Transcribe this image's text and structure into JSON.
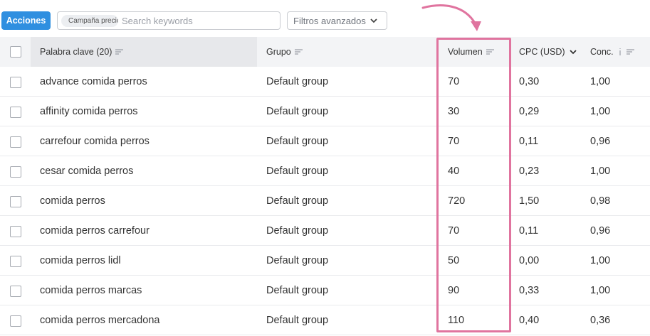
{
  "toolbar": {
    "actions_label": "Acciones",
    "campaign_chip": "Campaña precios",
    "search_placeholder": "Search keywords",
    "filters_label": "Filtros avanzados"
  },
  "table": {
    "headers": {
      "keyword": "Palabra clave (20)",
      "group": "Grupo",
      "volume": "Volumen",
      "cpc": "CPC (USD)",
      "competition": "Conc."
    },
    "rows": [
      {
        "keyword": "advance comida perros",
        "group": "Default group",
        "volume": "70",
        "cpc": "0,30",
        "competition": "1,00"
      },
      {
        "keyword": "affinity comida perros",
        "group": "Default group",
        "volume": "30",
        "cpc": "0,29",
        "competition": "1,00"
      },
      {
        "keyword": "carrefour comida perros",
        "group": "Default group",
        "volume": "70",
        "cpc": "0,11",
        "competition": "0,96"
      },
      {
        "keyword": "cesar comida perros",
        "group": "Default group",
        "volume": "40",
        "cpc": "0,23",
        "competition": "1,00"
      },
      {
        "keyword": "comida perros",
        "group": "Default group",
        "volume": "720",
        "cpc": "1,50",
        "competition": "0,98"
      },
      {
        "keyword": "comida perros carrefour",
        "group": "Default group",
        "volume": "70",
        "cpc": "0,11",
        "competition": "0,96"
      },
      {
        "keyword": "comida perros lidl",
        "group": "Default group",
        "volume": "50",
        "cpc": "0,00",
        "competition": "1,00"
      },
      {
        "keyword": "comida perros marcas",
        "group": "Default group",
        "volume": "90",
        "cpc": "0,33",
        "competition": "1,00"
      },
      {
        "keyword": "comida perros mercadona",
        "group": "Default group",
        "volume": "110",
        "cpc": "0,40",
        "competition": "0,36"
      }
    ]
  },
  "colors": {
    "primary_button": "#2f8fe0",
    "highlight": "#e0749f",
    "header_bg": "#f3f4f6"
  }
}
